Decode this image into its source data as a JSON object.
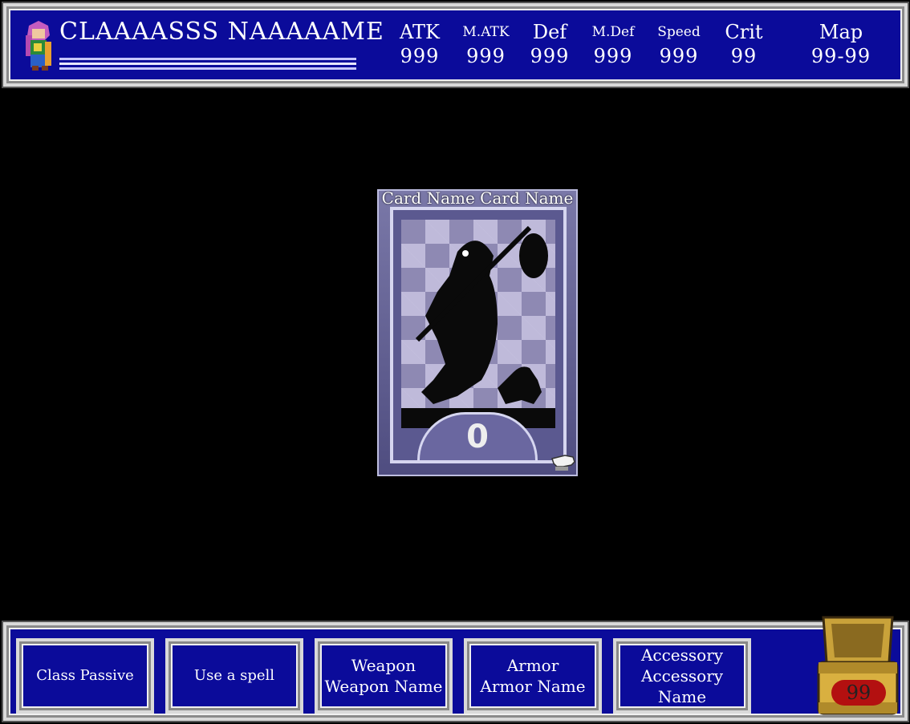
{
  "header": {
    "class_name": "CLAAAASSS NAAAAAME",
    "stats": [
      {
        "label": "ATK",
        "value": "999"
      },
      {
        "label": "M.ATK",
        "value": "999"
      },
      {
        "label": "Def",
        "value": "999"
      },
      {
        "label": "M.Def",
        "value": "999"
      },
      {
        "label": "Speed",
        "value": "999"
      },
      {
        "label": "Crit",
        "value": "99"
      },
      {
        "label": "Map",
        "value": "99-99"
      }
    ]
  },
  "card": {
    "name": "Card Name Card Name",
    "number": "0"
  },
  "actions": {
    "class_passive": "Class Passive",
    "use_spell": "Use a spell",
    "weapon_line1": "Weapon",
    "weapon_line2": "Weapon Name",
    "armor_line1": "Armor",
    "armor_line2": "Armor Name",
    "accessory_line1": "Accessory",
    "accessory_line2": "Accessory Name"
  },
  "chest": {
    "count": "99"
  },
  "colors": {
    "window": "#0b0b9a",
    "frame": "#d9d9d9",
    "background": "#000000"
  }
}
